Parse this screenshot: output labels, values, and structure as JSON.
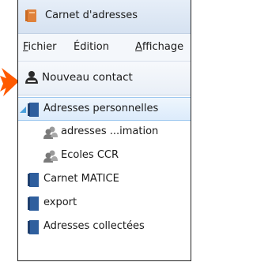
{
  "window": {
    "title": "Carnet d'adresses"
  },
  "menu": {
    "items": [
      {
        "label_pre": "",
        "label_ul": "F",
        "label_post": "ichier"
      },
      {
        "label_pre": "",
        "label_ul": "É",
        "label_post": "dition"
      },
      {
        "label_pre": "",
        "label_ul": "A",
        "label_post": "ffichage"
      }
    ]
  },
  "toolbar": {
    "new_contact_label": "Nouveau contact"
  },
  "tree": {
    "books": [
      {
        "label": "Adresses personnelles",
        "expanded": true,
        "children": [
          {
            "label": "adresses ...imation"
          },
          {
            "label": "Ecoles CCR"
          }
        ]
      },
      {
        "label": "Carnet MATICE"
      },
      {
        "label": "export"
      },
      {
        "label": "Adresses collectées"
      }
    ]
  },
  "colors": {
    "annotation_arrow": "#ff5a00",
    "selection": "#dcebfb",
    "book_blue": "#2f5f9e"
  }
}
